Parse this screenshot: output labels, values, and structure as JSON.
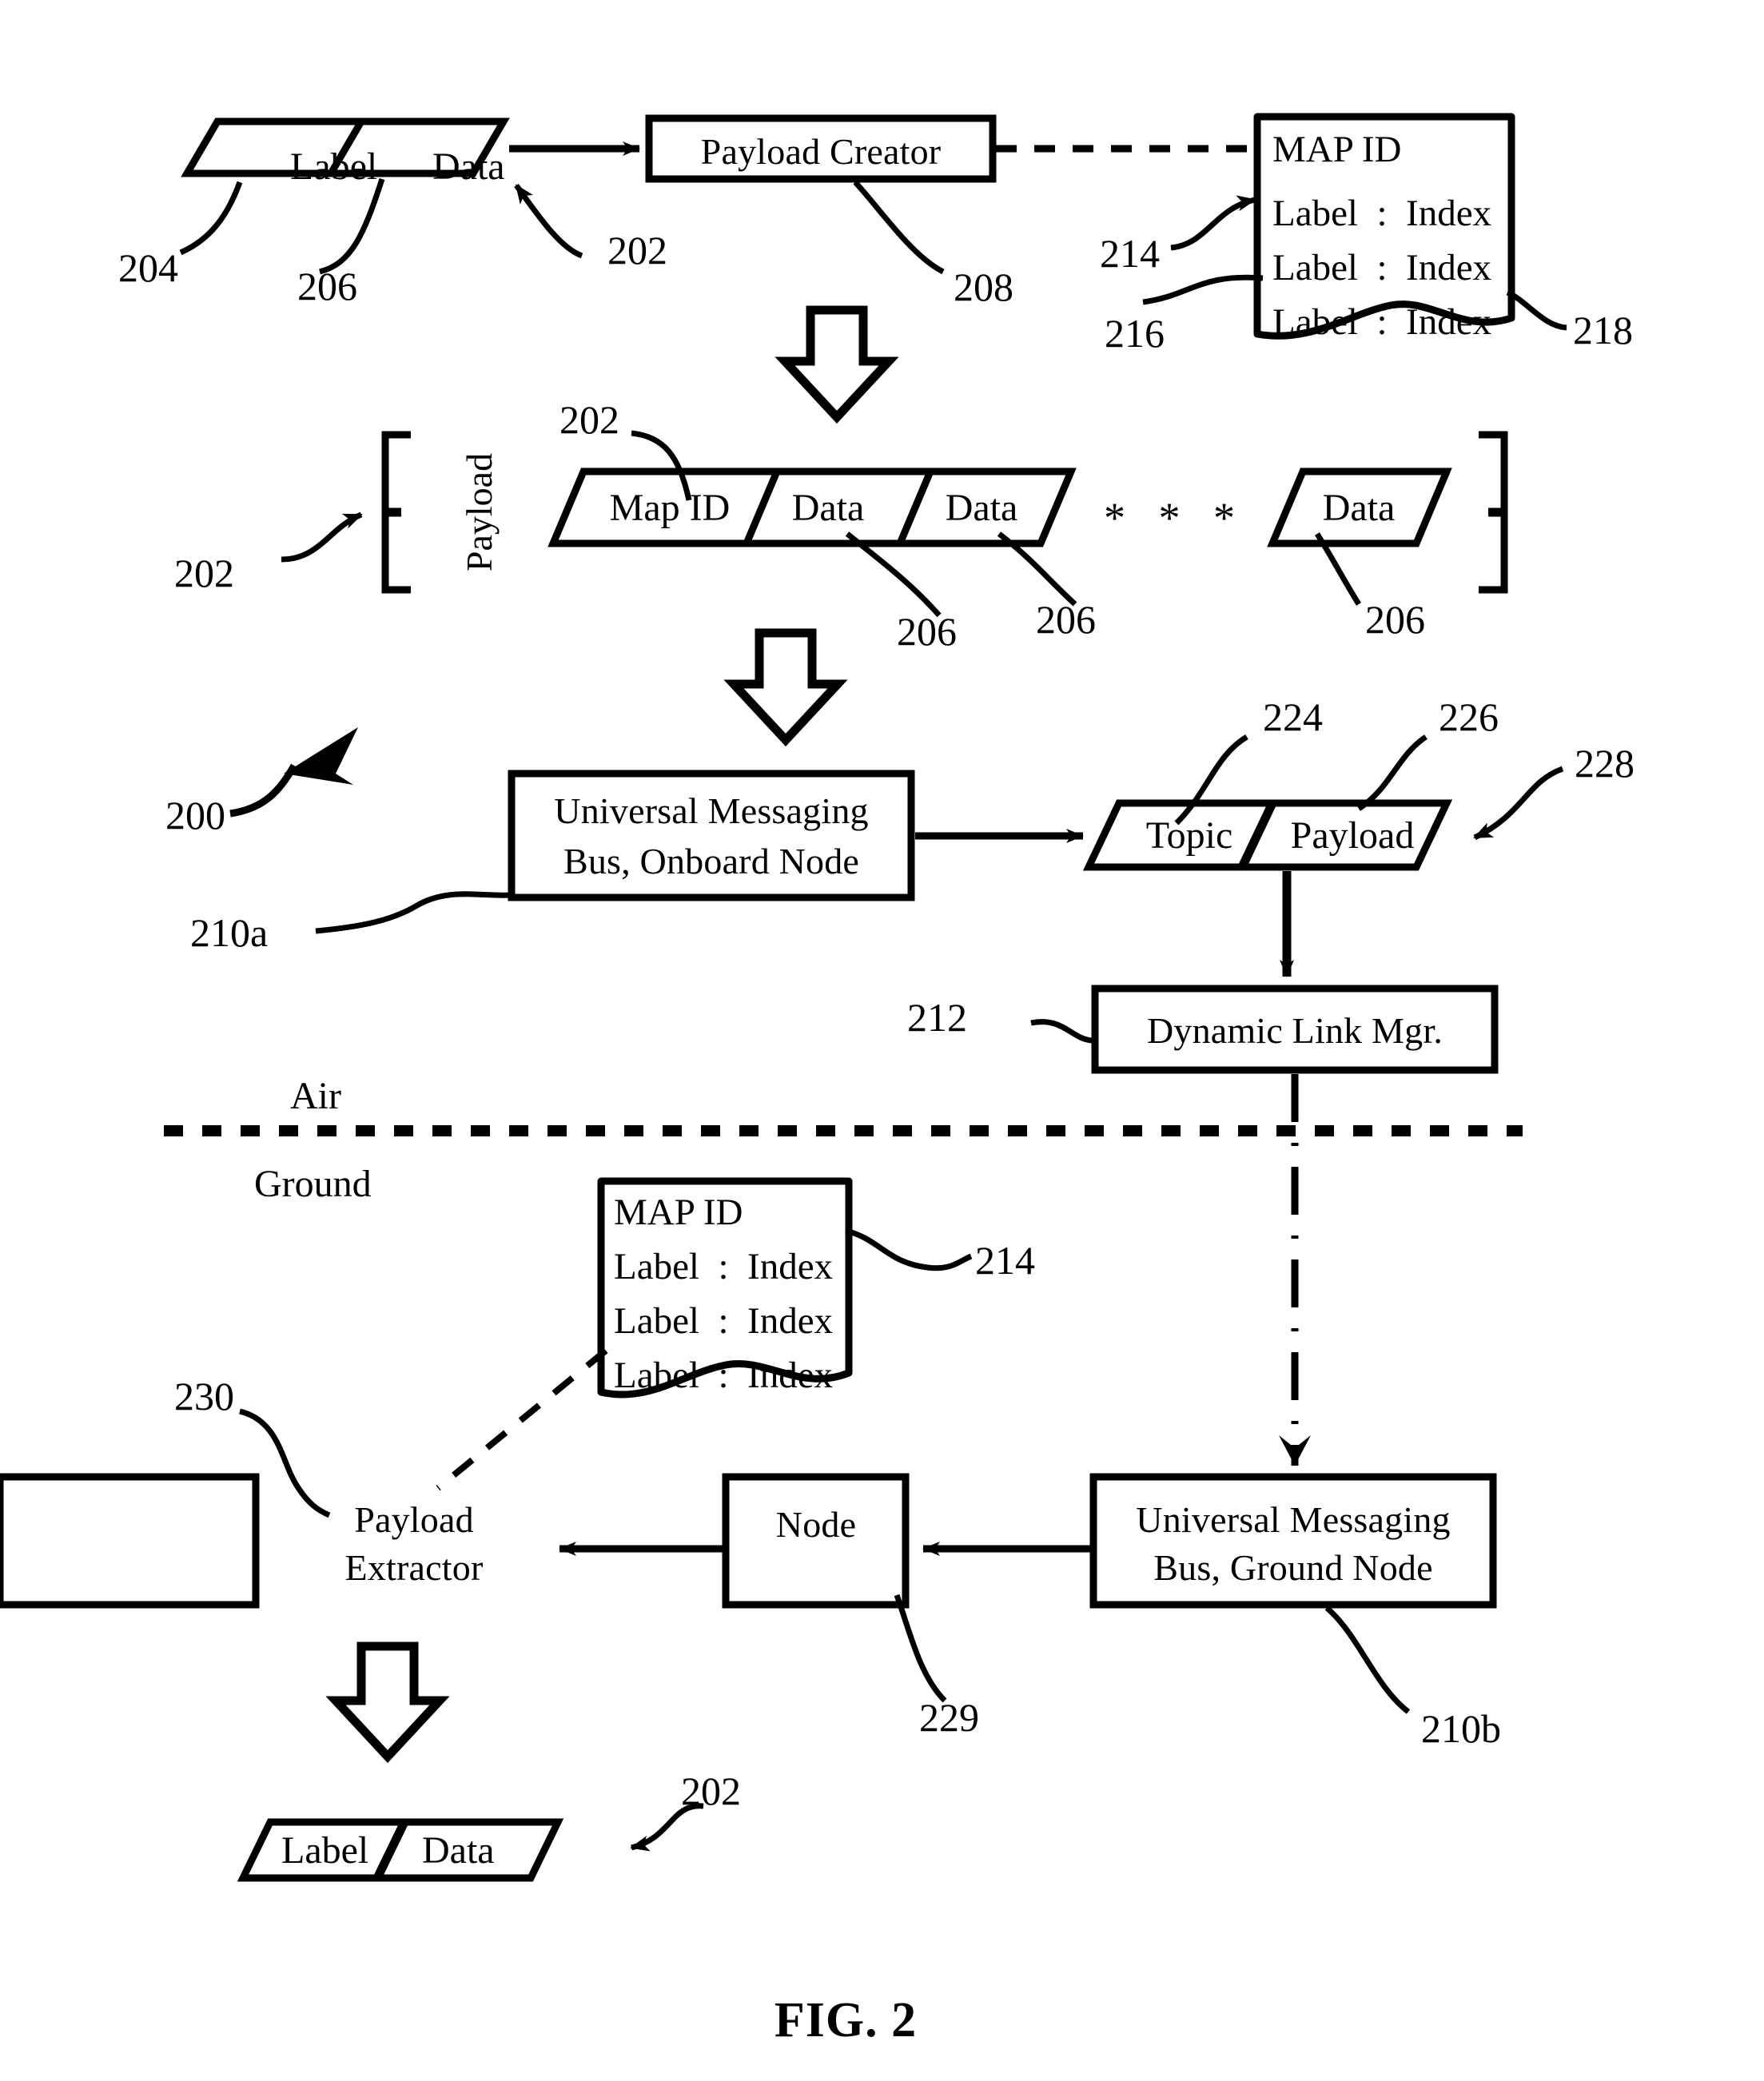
{
  "figure": {
    "caption": "FIG. 2",
    "overall_ref": "200"
  },
  "regions": {
    "air": "Air",
    "ground": "Ground"
  },
  "top_row": {
    "message": {
      "ref": "202",
      "cells": [
        {
          "label": "Label",
          "ref": "204"
        },
        {
          "label": "Data",
          "ref": "206"
        }
      ]
    },
    "payload_creator": {
      "label": "Payload Creator",
      "ref": "208"
    },
    "map_table": {
      "title": "MAP ID",
      "rows": [
        "Label  :  Index",
        "Label  :  Index",
        "Label  :  Index"
      ],
      "ref_table": "214",
      "ref_label": "216",
      "ref_index": "218"
    }
  },
  "payload_row": {
    "bracket_label": "Payload",
    "bracket_ref": "202",
    "mapid_ref": "202",
    "ellipsis": "* * *",
    "cells": [
      {
        "label": "Map ID",
        "ref": ""
      },
      {
        "label": "Data",
        "ref": "206"
      },
      {
        "label": "Data",
        "ref": "206"
      },
      {
        "label": "Data",
        "ref": "206"
      }
    ]
  },
  "bus_row": {
    "onboard_bus": {
      "line1": "Universal Messaging",
      "line2": "Bus, Onboard Node",
      "ref": "210a"
    },
    "message": {
      "topic": "Topic",
      "payload": "Payload",
      "ref_topic": "224",
      "ref_payload": "226",
      "ref_message": "228"
    }
  },
  "link_mgr": {
    "label": "Dynamic Link Mgr.",
    "ref": "212"
  },
  "ground_map_table": {
    "title": "MAP ID",
    "rows": [
      "Label  :  Index",
      "Label  :  Index",
      "Label  :  Index"
    ],
    "ref": "214"
  },
  "ground_row": {
    "extractor": {
      "line1": "Payload",
      "line2": "Extractor",
      "ref": "230"
    },
    "node": {
      "label": "Node",
      "ref": "229"
    },
    "ground_bus": {
      "line1": "Universal Messaging",
      "line2": "Bus, Ground Node",
      "ref": "210b"
    }
  },
  "output_message": {
    "ref": "202",
    "cells": [
      {
        "label": "Label"
      },
      {
        "label": "Data"
      }
    ]
  }
}
